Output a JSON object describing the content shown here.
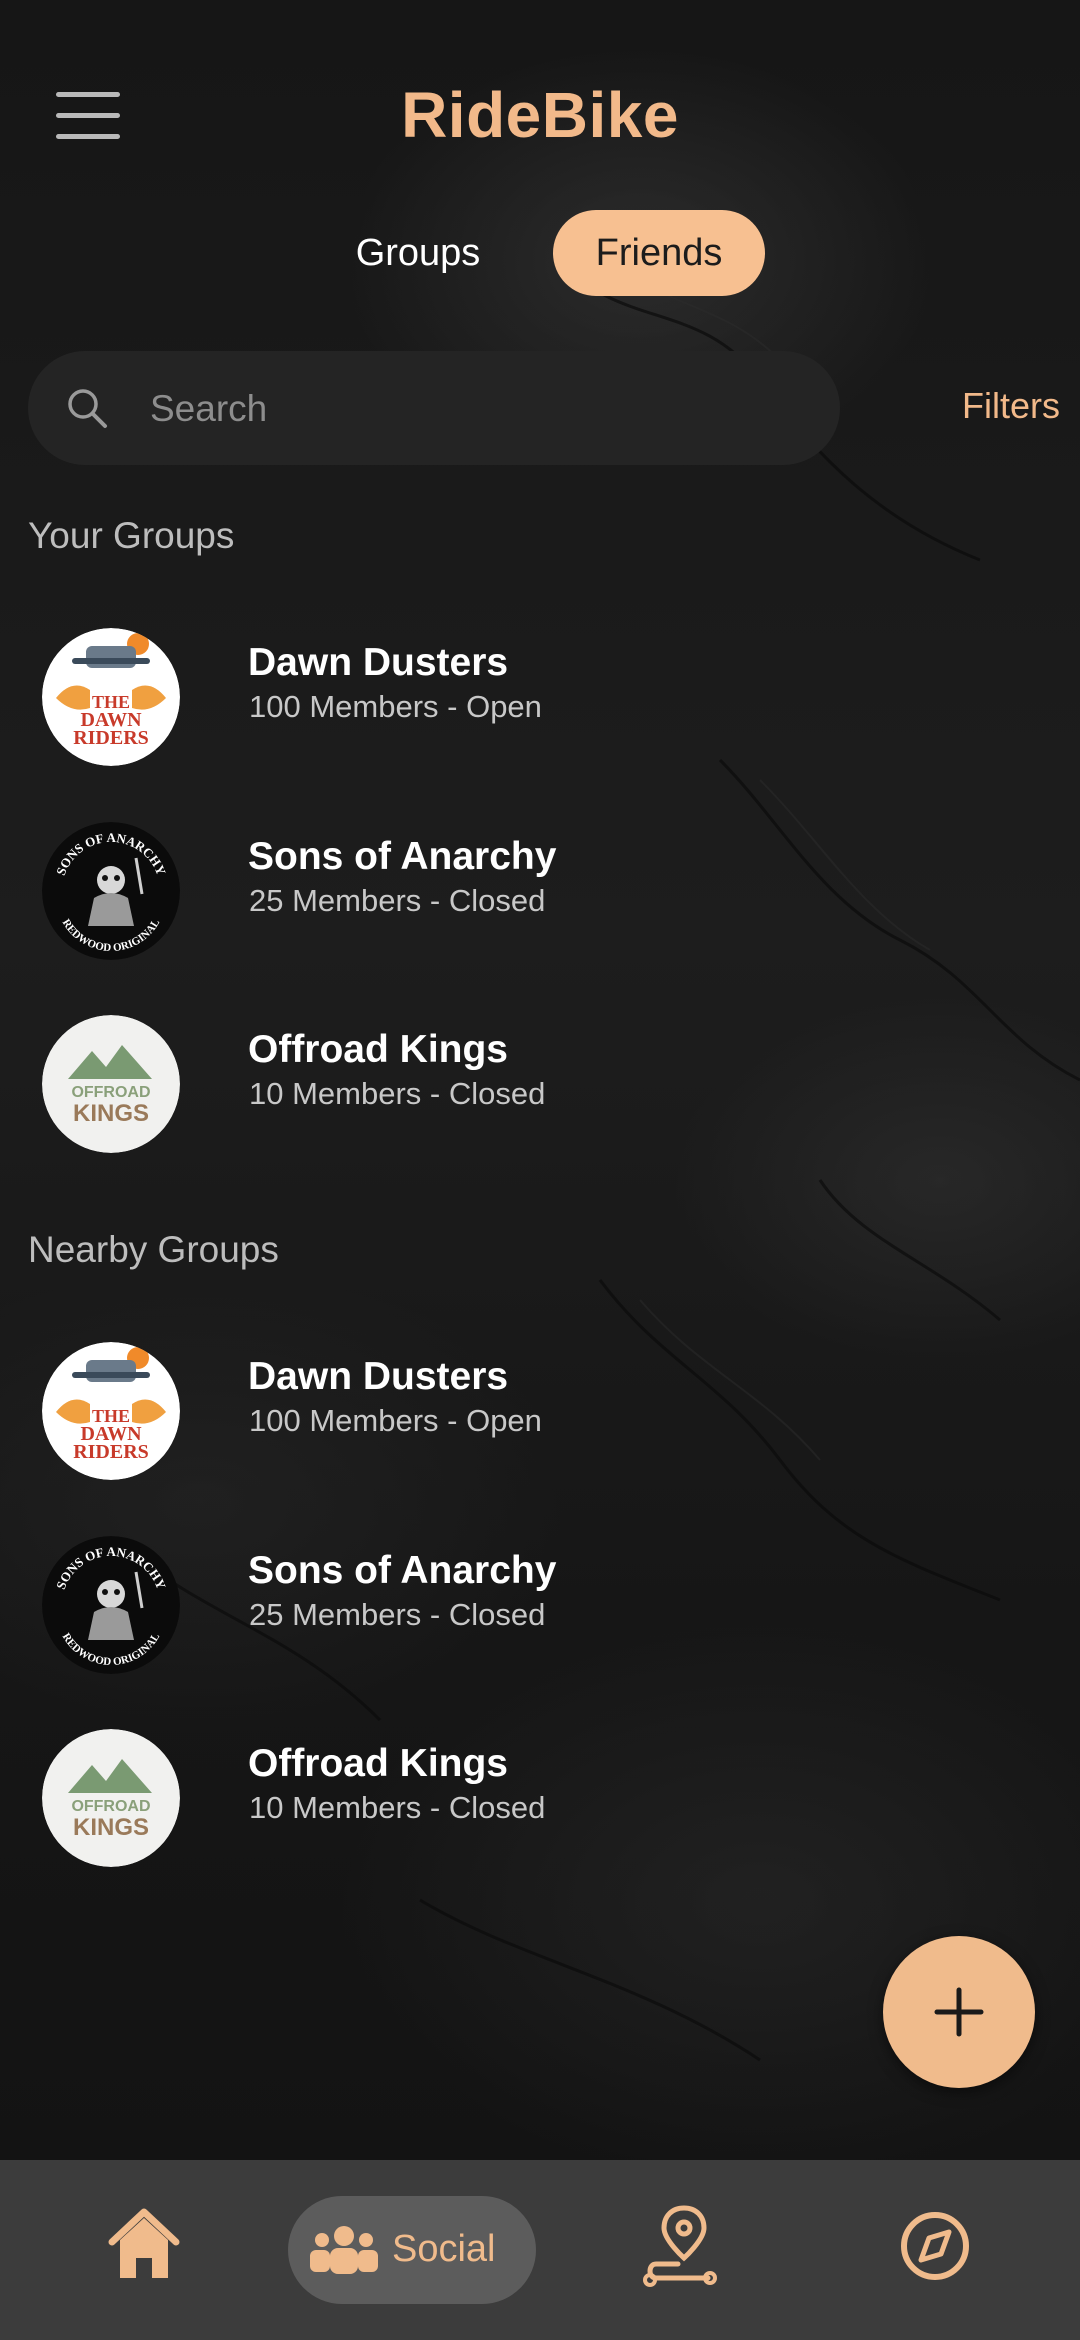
{
  "header": {
    "title": "RideBike"
  },
  "tabs": [
    {
      "label": "Groups",
      "active": false
    },
    {
      "label": "Friends",
      "active": true
    }
  ],
  "search": {
    "placeholder": "Search",
    "value": ""
  },
  "filters_label": "Filters",
  "your_groups": {
    "title": "Your Groups",
    "items": [
      {
        "name": "Dawn Dusters",
        "meta": "100 Members - Open",
        "icon": "dawn-riders-logo"
      },
      {
        "name": "Sons of Anarchy",
        "meta": "25 Members - Closed",
        "icon": "sons-of-anarchy-logo"
      },
      {
        "name": "Offroad Kings",
        "meta": "10 Members - Closed",
        "icon": "offroad-kings-logo"
      }
    ]
  },
  "nearby_groups": {
    "title": "Nearby Groups",
    "items": [
      {
        "name": "Dawn Dusters",
        "meta": "100 Members - Open",
        "icon": "dawn-riders-logo"
      },
      {
        "name": "Sons of Anarchy",
        "meta": "25 Members - Closed",
        "icon": "sons-of-anarchy-logo"
      },
      {
        "name": "Offroad Kings",
        "meta": "10 Members - Closed",
        "icon": "offroad-kings-logo"
      }
    ]
  },
  "logo_text": {
    "dawn": [
      "THE",
      "DAWN",
      "RIDERS"
    ],
    "soa": [
      "SONS OF ANARCHY",
      "REDWOOD ORIGINAL"
    ],
    "offroad": [
      "OFFROAD",
      "KINGS"
    ]
  },
  "bottom_nav": {
    "items": [
      {
        "icon": "home-icon",
        "label": ""
      },
      {
        "icon": "people-icon",
        "label": "Social",
        "active": true
      },
      {
        "icon": "route-icon",
        "label": ""
      },
      {
        "icon": "compass-icon",
        "label": ""
      }
    ]
  },
  "colors": {
    "accent": "#f2b98a",
    "tab_active_bg": "#f7c091",
    "background": "#171717",
    "nav_bg": "#3c3c3c"
  }
}
